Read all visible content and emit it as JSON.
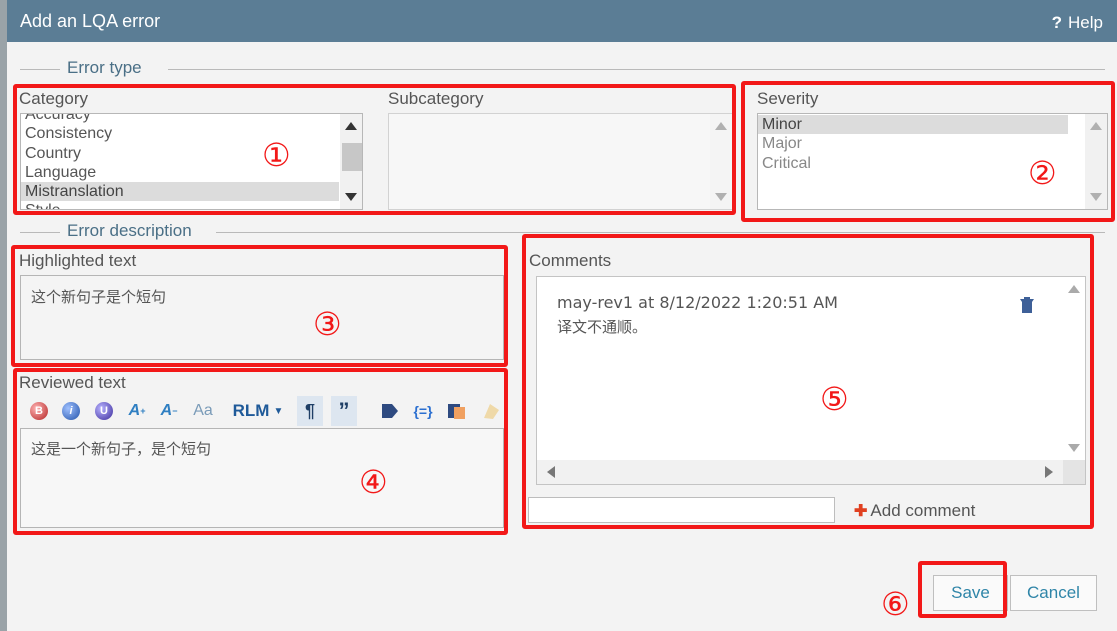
{
  "dialog": {
    "title": "Add an LQA error",
    "help_label": "Help",
    "help_icon": "?"
  },
  "error_type": {
    "section_label": "Error type",
    "category": {
      "label": "Category",
      "options": [
        "Accuracy",
        "Consistency",
        "Country",
        "Language",
        "Mistranslation",
        "Style"
      ],
      "selected": "Mistranslation"
    },
    "subcategory": {
      "label": "Subcategory",
      "options": []
    },
    "severity": {
      "label": "Severity",
      "options": [
        "Minor",
        "Major",
        "Critical"
      ],
      "selected": "Minor"
    }
  },
  "error_description": {
    "section_label": "Error description",
    "highlighted": {
      "label": "Highlighted text",
      "text": "这个新句子是个短句"
    },
    "reviewed": {
      "label": "Reviewed text",
      "text": "这是一个新句子，是个短句",
      "toolbar": {
        "rlm_label": "RLM",
        "icons": [
          "bold-icon",
          "italic-icon",
          "underline-icon",
          "superscript-icon",
          "subscript-icon",
          "change-case-icon",
          "rlm-dropdown",
          "pilcrow-icon",
          "quote-icon",
          "tag-icon",
          "placeholder-icon",
          "copy-source-icon",
          "clear-icon"
        ]
      }
    },
    "comments": {
      "label": "Comments",
      "items": [
        {
          "author_time": "may-rev1 at 8/12/2022 1:20:51 AM",
          "text": "译文不通顺。"
        }
      ],
      "input_value": "",
      "add_label": "Add comment"
    }
  },
  "footer": {
    "save_label": "Save",
    "cancel_label": "Cancel"
  },
  "annotations": {
    "markers": [
      "①",
      "②",
      "③",
      "④",
      "⑤",
      "⑥"
    ],
    "color": "#f21818"
  },
  "theme": {
    "titlebar": "#5b7d95",
    "section_label": "#4a6f86",
    "button_text": "#2f85a8"
  }
}
